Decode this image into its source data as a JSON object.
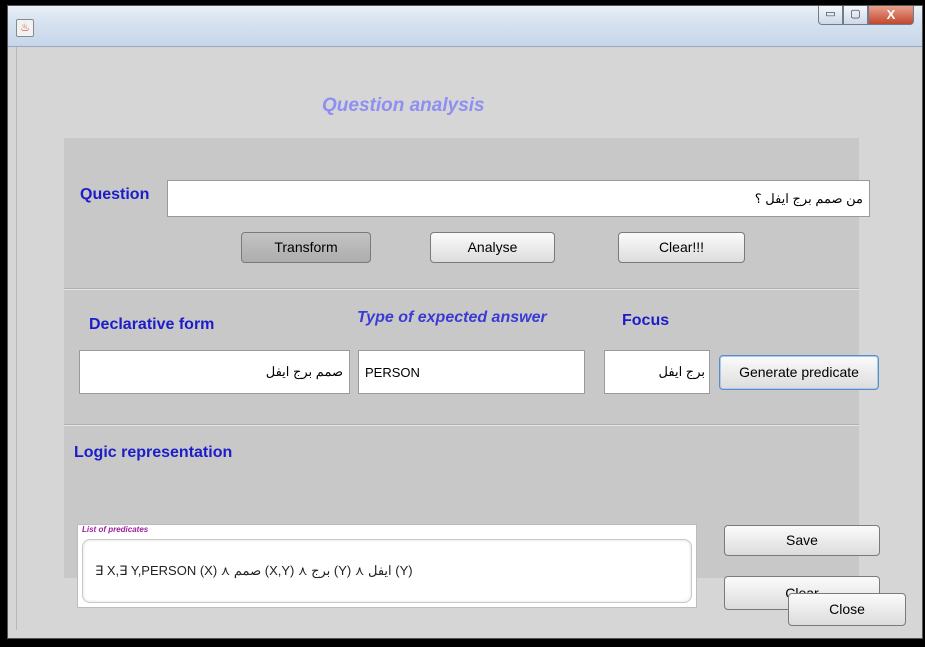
{
  "window": {
    "icon": "java-cup-icon",
    "buttons": {
      "minimize": "▭",
      "maximize": "▢",
      "close": "X"
    }
  },
  "heading": "Question analysis",
  "question": {
    "label": "Question",
    "value": "من صمم برج ايفل ؟",
    "transform_label": "Transform",
    "analyse_label": "Analyse",
    "clear_label": "Clear!!!"
  },
  "analysis": {
    "declarative_label": "Declarative form",
    "declarative_value": "صمم برج ايفل",
    "answer_type_label": "Type of expected answer",
    "answer_type_value": "PERSON",
    "focus_label": "Focus",
    "focus_value": "برج ايفل",
    "generate_label": "Generate predicate"
  },
  "logic": {
    "label": "Logic representation",
    "list_title": "List of predicates",
    "predicates": "∃ X,∃ Y,PERSON (X) ⋏ صمم (X,Y) ⋏ برج (Y) ⋏ ايفل (Y)",
    "save_label": "Save",
    "clear_label": "Clear"
  },
  "close_label": "Close"
}
